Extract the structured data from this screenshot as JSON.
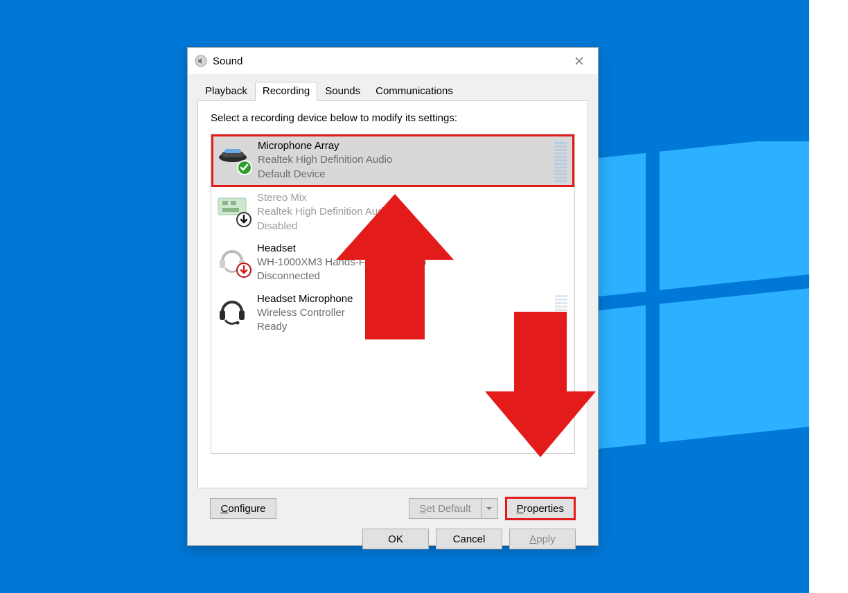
{
  "window": {
    "title": "Sound",
    "close": "Close"
  },
  "tabs": {
    "playback": "Playback",
    "recording": "Recording",
    "sounds": "Sounds",
    "communications": "Communications",
    "active": "recording"
  },
  "instruction": "Select a recording device below to modify its settings:",
  "devices": [
    {
      "name": "Microphone Array",
      "sub1": "Realtek High Definition Audio",
      "sub2": "Default Device",
      "state": "default",
      "selected": true,
      "meter": "active"
    },
    {
      "name": "Stereo Mix",
      "sub1": "Realtek High Definition Audio",
      "sub2": "Disabled",
      "state": "disabled",
      "selected": false,
      "meter": "none"
    },
    {
      "name": "Headset",
      "sub1": "WH-1000XM3 Hands-Free AG Audio",
      "sub2": "Disconnected",
      "state": "disconnected",
      "selected": false,
      "meter": "none"
    },
    {
      "name": "Headset Microphone",
      "sub1": "Wireless Controller",
      "sub2": "Ready",
      "state": "ready",
      "selected": false,
      "meter": "dim"
    }
  ],
  "buttons": {
    "configure": "Configure",
    "configure_underline": "C",
    "set_default": "Set Default",
    "set_default_underline": "S",
    "properties": "Properties",
    "properties_underline": "P",
    "ok": "OK",
    "cancel": "Cancel",
    "apply": "Apply",
    "apply_underline": "A"
  },
  "colors": {
    "desktop": "#0078d7",
    "highlight": "#e31b1b"
  }
}
